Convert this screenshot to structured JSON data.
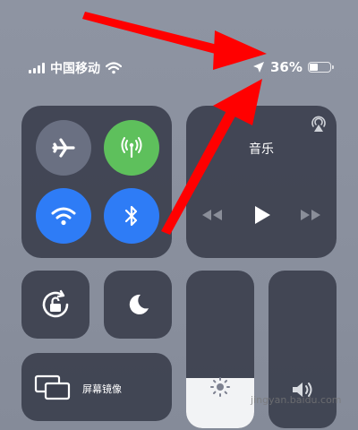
{
  "status_bar": {
    "carrier": "中国移动",
    "battery_percent": "36%",
    "battery_level": 0.36
  },
  "music": {
    "title": "音乐"
  },
  "screen_mirroring": {
    "label": "屏幕镜像"
  },
  "sliders": {
    "brightness_level": 0.32,
    "volume_level": 0.0
  },
  "watermark": {
    "text": "jingyan.baidu.com"
  },
  "icons": {
    "airplane": "airplane-icon",
    "cellular": "antenna-icon",
    "wifi": "wifi-icon",
    "bluetooth": "bluetooth-icon",
    "airplay": "airplay-icon",
    "rewind": "rewind-icon",
    "play": "play-icon",
    "forward": "fast-forward-icon",
    "rotation_lock": "rotation-lock-icon",
    "dnd": "moon-icon",
    "mirroring": "screen-mirroring-icon",
    "brightness": "sun-icon",
    "volume": "speaker-icon",
    "location": "location-arrow-icon"
  },
  "colors": {
    "green": "#5ec05c",
    "blue": "#2e7cf6",
    "annotation_arrow": "#ff0000"
  }
}
